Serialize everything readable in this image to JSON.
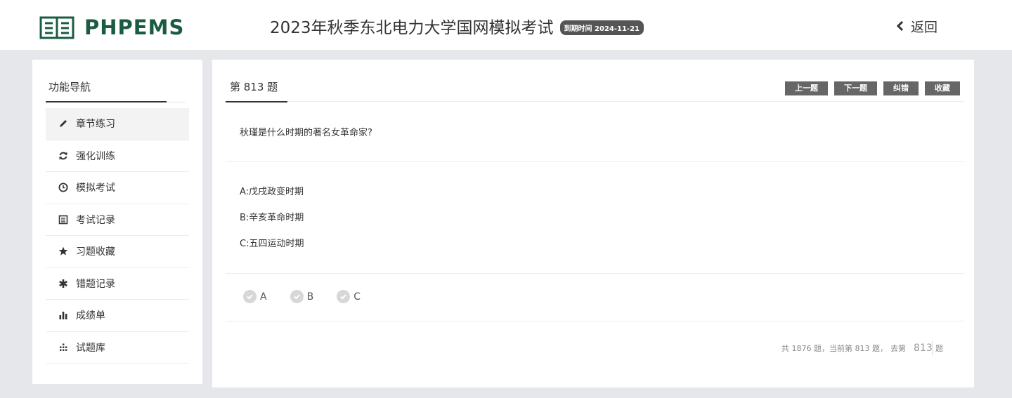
{
  "header": {
    "logo_text": "PHPEMS",
    "exam_title": "2023年秋季东北电力大学国网模拟考试",
    "expiry_badge": "到期时间 2024-11-21",
    "back_label": "返回"
  },
  "sidebar": {
    "title": "功能导航",
    "items": [
      {
        "label": "章节练习",
        "icon": "pencil-icon"
      },
      {
        "label": "强化训练",
        "icon": "refresh-icon"
      },
      {
        "label": "模拟考试",
        "icon": "clock-icon"
      },
      {
        "label": "考试记录",
        "icon": "list-icon"
      },
      {
        "label": "习题收藏",
        "icon": "star-icon"
      },
      {
        "label": "错题记录",
        "icon": "asterisk-icon"
      },
      {
        "label": "成绩单",
        "icon": "bar-chart-icon"
      },
      {
        "label": "试题库",
        "icon": "grid-icon"
      }
    ]
  },
  "question": {
    "tab_label": "第 813 题",
    "buttons": {
      "prev": "上一题",
      "next": "下一题",
      "report": "纠错",
      "favorite": "收藏"
    },
    "text": "秋瑾是什么时期的著名女革命家?",
    "options": [
      "A:戊戌政变时期",
      "B:辛亥革命时期",
      "C:五四运动时期"
    ],
    "answer_choices": [
      "A",
      "B",
      "C"
    ]
  },
  "pager": {
    "summary": "共 1876 题，当前第 813 题，",
    "goto_prefix": "去第",
    "goto_value": "813",
    "goto_suffix": "题"
  },
  "colors": {
    "brand": "#1a5c41",
    "button": "#666666",
    "background": "#e6e7ea"
  }
}
